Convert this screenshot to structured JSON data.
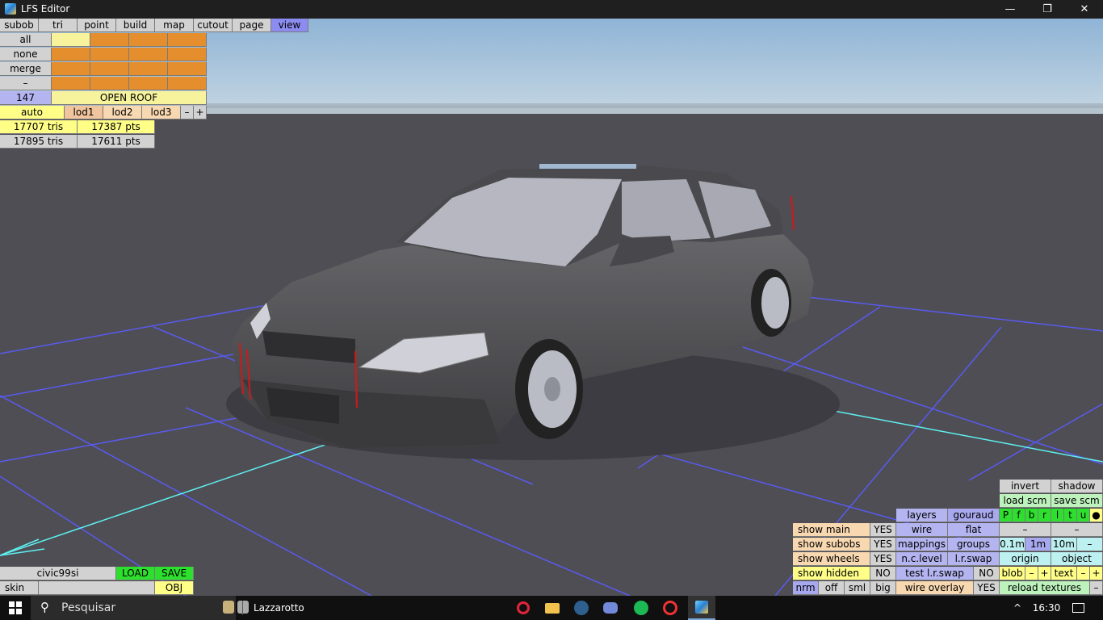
{
  "window": {
    "title": "LFS Editor",
    "minimize": "—",
    "restore": "❐",
    "close": "✕"
  },
  "menu": [
    "subob",
    "tri",
    "point",
    "build",
    "map",
    "cutout",
    "page",
    "view"
  ],
  "subob_panel": {
    "side_buttons": [
      "all",
      "none",
      "merge",
      "–"
    ],
    "count": "147",
    "selected_name": "OPEN ROOF"
  },
  "lod": {
    "auto": "auto",
    "lod1": "lod1",
    "lod2": "lod2",
    "lod3": "lod3",
    "minus": "–",
    "plus": "+"
  },
  "stats": {
    "row1_tris": "17707 tris",
    "row1_pts": "17387 pts",
    "row2_tris": "17895 tris",
    "row2_pts": "17611 pts"
  },
  "bottom_left": {
    "model_name": "civic99si",
    "load": "LOAD",
    "save": "SAVE",
    "skin": "skin",
    "skin_value": "",
    "obj": "OBJ"
  },
  "view_panel": {
    "invert": "invert",
    "shadow": "shadow",
    "load_scm": "load scm",
    "save_scm": "save scm",
    "letters": [
      "P",
      "f",
      "b",
      "r",
      "l",
      "t",
      "u",
      "●"
    ],
    "layers": "layers",
    "gouraud": "gouraud",
    "wire": "wire",
    "flat": "flat",
    "dash1": "–",
    "dash2": "–",
    "mappings": "mappings",
    "groups": "groups",
    "d01": "0.1m",
    "d1": "1m",
    "d10": "10m",
    "dminus": "–",
    "nclevel": "n.c.level",
    "lrswap": "l.r.swap",
    "origin": "origin",
    "object": "object",
    "test_lr_swap": "test l.r.swap",
    "test_val": "NO",
    "blob": "blob",
    "blob_minus": "–",
    "blob_plus": "+",
    "text": "text",
    "text_minus": "–",
    "text_plus": "+",
    "wire_overlay": "wire overlay",
    "wire_overlay_val": "YES",
    "reload_textures": "reload textures",
    "reload_dash": "–",
    "show_main": "show main",
    "show_main_val": "YES",
    "show_subobs": "show subobs",
    "show_subobs_val": "YES",
    "show_wheels": "show wheels",
    "show_wheels_val": "YES",
    "show_hidden": "show hidden",
    "show_hidden_val": "NO",
    "nrm": "nrm",
    "off": "off",
    "sml": "sml",
    "big": "big"
  },
  "taskbar": {
    "search_placeholder": "Pesquisar",
    "active_window": "Lazzarotto",
    "time": "16:30",
    "tray_up": "^"
  },
  "icons": {
    "start": "windows-start-icon",
    "search": "search-icon",
    "opera": "opera-icon",
    "folder": "file-explorer-icon",
    "steam": "steam-icon",
    "discord": "discord-icon",
    "spotify": "spotify-icon",
    "other": "app-icon",
    "lfs": "lfs-editor-icon"
  }
}
